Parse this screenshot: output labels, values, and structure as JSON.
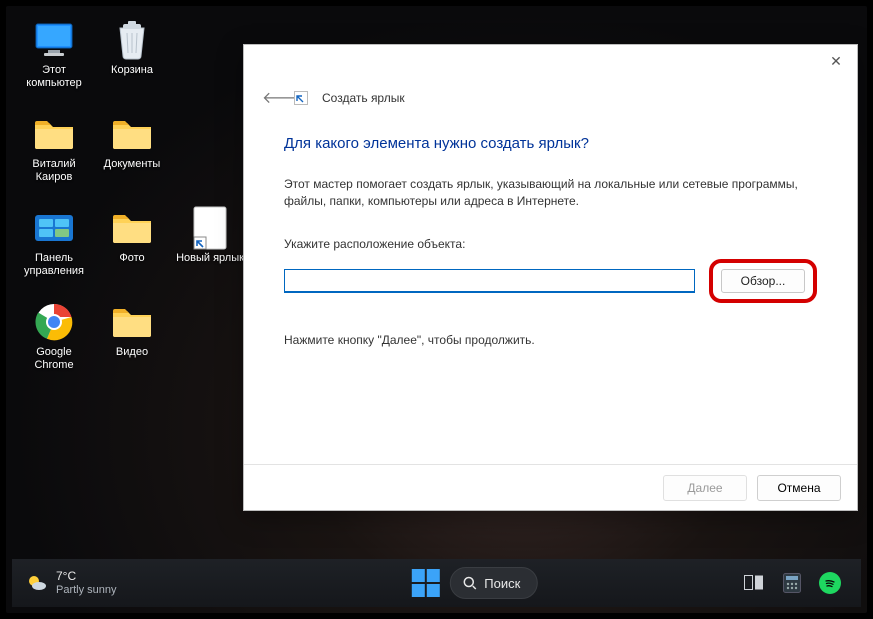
{
  "desktop": {
    "icons": [
      {
        "id": "this-pc",
        "label": "Этот компьютер"
      },
      {
        "id": "recycle-bin",
        "label": "Корзина"
      },
      {
        "id": "user-folder",
        "label": "Виталий Каиров"
      },
      {
        "id": "documents",
        "label": "Документы"
      },
      {
        "id": "control-panel",
        "label": "Панель управления"
      },
      {
        "id": "photo",
        "label": "Фото"
      },
      {
        "id": "new-shortcut",
        "label": "Новый ярлык"
      },
      {
        "id": "chrome",
        "label": "Google Chrome"
      },
      {
        "id": "video",
        "label": "Видео"
      }
    ]
  },
  "dialog": {
    "breadcrumb": "Создать ярлык",
    "title": "Для какого элемента нужно создать ярлык?",
    "description": "Этот мастер помогает создать ярлык, указывающий на локальные или сетевые программы, файлы, папки, компьютеры или адреса в Интернете.",
    "location_label": "Укажите расположение объекта:",
    "path_value": "",
    "browse": "Обзор...",
    "hint": "Нажмите кнопку \"Далее\", чтобы продолжить.",
    "next": "Далее",
    "cancel": "Отмена"
  },
  "taskbar": {
    "temp": "7°C",
    "weather": "Partly sunny",
    "search": "Поиск"
  }
}
